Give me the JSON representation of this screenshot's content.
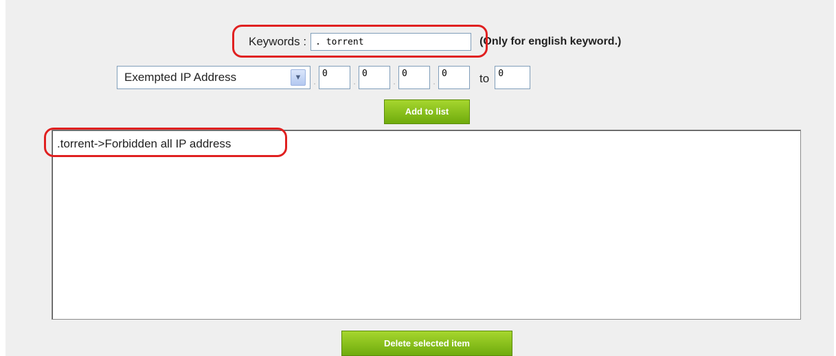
{
  "keywords": {
    "label": "Keywords :",
    "value": ". torrent",
    "note": "(Only for english keyword.)"
  },
  "ip_filter": {
    "select_value": "Exempted IP Address",
    "octets": [
      "0",
      "0",
      "0",
      "0"
    ],
    "to_label": "to",
    "to_value": "0",
    "separator": "."
  },
  "buttons": {
    "add_label": "Add to list",
    "delete_label": "Delete selected item"
  },
  "list": {
    "items": [
      ".torrent->Forbidden all IP address"
    ]
  },
  "colors": {
    "highlight": "#e02020",
    "button_green": "#8cc41c",
    "panel_bg": "#efefef"
  }
}
